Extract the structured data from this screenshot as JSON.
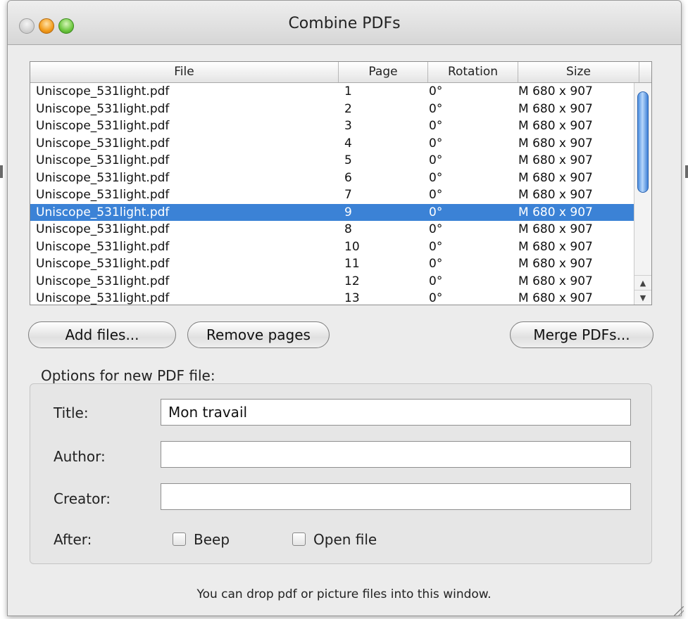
{
  "window": {
    "title": "Combine PDFs"
  },
  "table": {
    "columns": [
      "File",
      "Page",
      "Rotation",
      "Size"
    ],
    "rows": [
      {
        "file": "Uniscope_531light.pdf",
        "page": "1",
        "rotation": "0°",
        "size": "M 680 x 907"
      },
      {
        "file": "Uniscope_531light.pdf",
        "page": "2",
        "rotation": "0°",
        "size": "M 680 x 907"
      },
      {
        "file": "Uniscope_531light.pdf",
        "page": "3",
        "rotation": "0°",
        "size": "M 680 x 907"
      },
      {
        "file": "Uniscope_531light.pdf",
        "page": "4",
        "rotation": "0°",
        "size": "M 680 x 907"
      },
      {
        "file": "Uniscope_531light.pdf",
        "page": "5",
        "rotation": "0°",
        "size": "M 680 x 907"
      },
      {
        "file": "Uniscope_531light.pdf",
        "page": "6",
        "rotation": "0°",
        "size": "M 680 x 907"
      },
      {
        "file": "Uniscope_531light.pdf",
        "page": "7",
        "rotation": "0°",
        "size": "M 680 x 907"
      },
      {
        "file": "Uniscope_531light.pdf",
        "page": "9",
        "rotation": "0°",
        "size": "M 680 x 907",
        "selected": true
      },
      {
        "file": "Uniscope_531light.pdf",
        "page": "8",
        "rotation": "0°",
        "size": "M 680 x 907"
      },
      {
        "file": "Uniscope_531light.pdf",
        "page": "10",
        "rotation": "0°",
        "size": "M 680 x 907"
      },
      {
        "file": "Uniscope_531light.pdf",
        "page": "11",
        "rotation": "0°",
        "size": "M 680 x 907"
      },
      {
        "file": "Uniscope_531light.pdf",
        "page": "12",
        "rotation": "0°",
        "size": "M 680 x 907"
      },
      {
        "file": "Uniscope_531light.pdf",
        "page": "13",
        "rotation": "0°",
        "size": "M 680 x 907"
      }
    ]
  },
  "buttons": {
    "add": "Add files...",
    "remove": "Remove pages",
    "merge": "Merge PDFs..."
  },
  "options": {
    "heading": "Options for new PDF file:",
    "title_label": "Title:",
    "title_value": "Mon travail",
    "author_label": "Author:",
    "author_value": "",
    "creator_label": "Creator:",
    "creator_value": "",
    "after_label": "After:",
    "beep_label": "Beep",
    "beep_checked": false,
    "open_label": "Open file",
    "open_checked": false
  },
  "footer": "You can drop pdf or picture files into this window.",
  "colors": {
    "selection": "#3b82d6",
    "window_bg": "#ececec"
  }
}
